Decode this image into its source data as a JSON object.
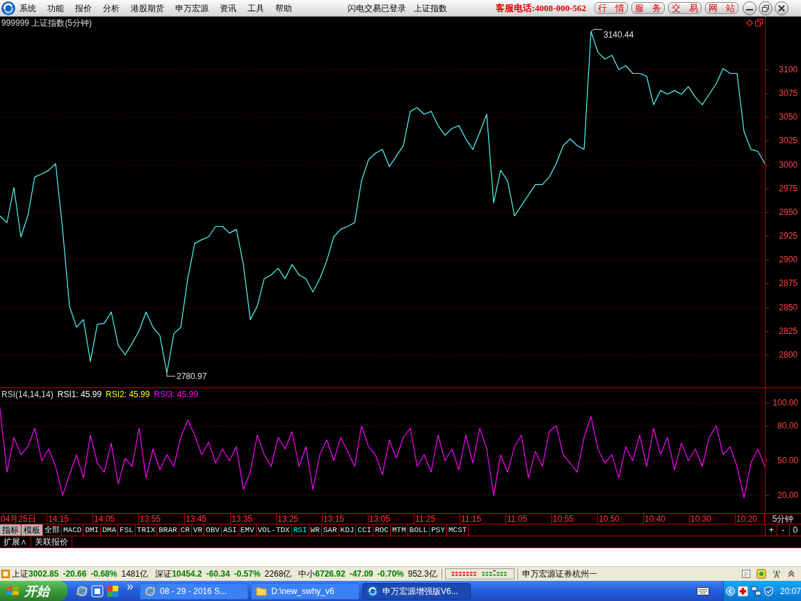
{
  "menu_bar": {
    "items": [
      "系统",
      "功能",
      "报价",
      "分析",
      "港股期货",
      "申万宏源",
      "资讯",
      "工具",
      "帮助"
    ],
    "status": [
      "闪电交易已登录",
      "上证指数"
    ],
    "hotline": "客服电话:4008-000-562",
    "buttons": [
      "行 情",
      "服 务",
      "交 易",
      "网 站"
    ]
  },
  "main_chart": {
    "title": "999999 上证指数(5分钟)",
    "chart_data": {
      "type": "line",
      "grid": true,
      "ylim": [
        2765.6,
        3155.6
      ],
      "yticks": [
        2800,
        2825,
        2850,
        2875,
        2900,
        2925,
        2950,
        2975,
        3000,
        3025,
        3050,
        3075,
        3100
      ],
      "series": [
        {
          "color": "#54fcfc",
          "values": [
            2946,
            2939,
            2976,
            2924,
            2946,
            2987,
            2990,
            2994,
            3001,
            2932,
            2851,
            2829,
            2837,
            2793,
            2832,
            2833,
            2845,
            2810,
            2800,
            2812,
            2825,
            2845,
            2829,
            2820,
            2781,
            2822,
            2829,
            2880,
            2917,
            2921,
            2924,
            2935,
            2935,
            2928,
            2932,
            2895,
            2837,
            2851,
            2880,
            2884,
            2891,
            2880,
            2895,
            2884,
            2880,
            2866,
            2880,
            2899,
            2924,
            2932,
            2935,
            2939,
            2983,
            3005,
            3012,
            3016,
            2998,
            3009,
            3020,
            3056,
            3060,
            3053,
            3056,
            3041,
            3031,
            3038,
            3041,
            3027,
            3016,
            3034,
            3053,
            2960,
            2994,
            2983,
            2946,
            2957,
            2968,
            2979,
            2979,
            2987,
            3001,
            3020,
            3027,
            3020,
            3016,
            3140,
            3118,
            3111,
            3115,
            3100,
            3104,
            3096,
            3096,
            3093,
            3063,
            3078,
            3074,
            3078,
            3074,
            3082,
            3071,
            3063,
            3074,
            3085,
            3101,
            3096,
            3096,
            3035,
            3016,
            3014,
            3001
          ]
        }
      ],
      "annotations": [
        "3140.44",
        "2780.97"
      ]
    }
  },
  "rsi_panel": {
    "title": "RSI(14,14,14)",
    "legend": [
      {
        "label": "RSI1: 45.99",
        "color": "#ffffff"
      },
      {
        "label": "RSI2: 45.99",
        "color": "#ffff00"
      },
      {
        "label": "RSI3: 45.99",
        "color": "#ff00ff"
      }
    ],
    "chart_data": {
      "type": "line",
      "grid": true,
      "ylim": [
        4.5,
        112.5
      ],
      "yticks": [
        {
          "value": 20,
          "label": "20.00"
        },
        {
          "value": 50,
          "label": "50.00"
        },
        {
          "value": 80,
          "label": "80.00"
        },
        {
          "value": 100,
          "label": "100.00"
        }
      ],
      "series": [
        {
          "color": "#ff00ff",
          "values": [
            95,
            40,
            70,
            55,
            62,
            78,
            50,
            60,
            45,
            20,
            38,
            55,
            35,
            72,
            48,
            40,
            65,
            30,
            52,
            45,
            78,
            35,
            60,
            42,
            55,
            45,
            70,
            85,
            72,
            55,
            66,
            48,
            60,
            50,
            62,
            25,
            40,
            72,
            55,
            45,
            70,
            60,
            75,
            45,
            62,
            25,
            55,
            68,
            50,
            70,
            58,
            45,
            80,
            62,
            55,
            38,
            68,
            52,
            70,
            78,
            45,
            55,
            40,
            72,
            50,
            60,
            42,
            72,
            48,
            78,
            60,
            20,
            55,
            40,
            62,
            72,
            35,
            58,
            45,
            75,
            80,
            55,
            48,
            40,
            70,
            88,
            60,
            48,
            55,
            35,
            62,
            50,
            72,
            45,
            78,
            55,
            70,
            42,
            65,
            50,
            60,
            45,
            70,
            80,
            55,
            62,
            45,
            18,
            48,
            60,
            45
          ]
        }
      ]
    }
  },
  "time_axis": {
    "labels": [
      "04月25日",
      "14:15",
      "14:05",
      "13:55",
      "13:45",
      "13:35",
      "13:25",
      "13:15",
      "13:05",
      "11:25",
      "11:15",
      "11:05",
      "10:55",
      "10:50",
      "10:40",
      "10:30",
      "10:20"
    ],
    "period": "5分钟"
  },
  "mode_buttons": [
    "指标",
    "模板"
  ],
  "indicator_tabs": [
    {
      "label": "全部",
      "selected": false
    },
    {
      "label": "MACD",
      "selected": false
    },
    {
      "label": "DMI",
      "selected": false
    },
    {
      "label": "DMA",
      "selected": false
    },
    {
      "label": "FSL",
      "selected": false
    },
    {
      "label": "TRIX",
      "selected": false
    },
    {
      "label": "BRAR",
      "selected": false
    },
    {
      "label": "CR",
      "selected": false
    },
    {
      "label": "VR",
      "selected": false
    },
    {
      "label": "OBV",
      "selected": false
    },
    {
      "label": "ASI",
      "selected": false
    },
    {
      "label": "EMV",
      "selected": false
    },
    {
      "label": "VOL-TDX",
      "selected": false
    },
    {
      "label": "RSI",
      "selected": true
    },
    {
      "label": "WR",
      "selected": false
    },
    {
      "label": "SAR",
      "selected": false
    },
    {
      "label": "KDJ",
      "selected": false
    },
    {
      "label": "CCI",
      "selected": false
    },
    {
      "label": "ROC",
      "selected": false
    },
    {
      "label": "MTM",
      "selected": false
    },
    {
      "label": "BOLL",
      "selected": false
    },
    {
      "label": "PSY",
      "selected": false
    },
    {
      "label": "MCST",
      "selected": false
    }
  ],
  "zoom_buttons": [
    "+",
    "-",
    "0"
  ],
  "bottom_tabs": [
    "扩展∧",
    "关联报价"
  ],
  "status_bar": {
    "indices": [
      {
        "name": "上证",
        "value": "3002.85",
        "change": "-20.66",
        "percent": "-0.68%",
        "amount": "1481亿",
        "falling": true
      },
      {
        "name": "深证",
        "value": "10454.2",
        "change": "-60.34",
        "percent": "-0.57%",
        "amount": "2268亿",
        "falling": true
      },
      {
        "name": "中小",
        "value": "6726.92",
        "change": "-47.09",
        "percent": "-0.70%",
        "amount": "952.3亿",
        "falling": true
      }
    ],
    "broker": "申万宏源证券杭州一"
  },
  "taskbar": {
    "start": "开始",
    "tasks": [
      {
        "label": "08 - 29 - 2016 S...",
        "kind": "browser",
        "selected": false
      },
      {
        "label": "D:\\new_swhy_v6",
        "kind": "folder",
        "selected": false
      },
      {
        "label": "申万宏源增强版V6...",
        "kind": "app",
        "selected": true
      }
    ],
    "clock": "20:07"
  }
}
